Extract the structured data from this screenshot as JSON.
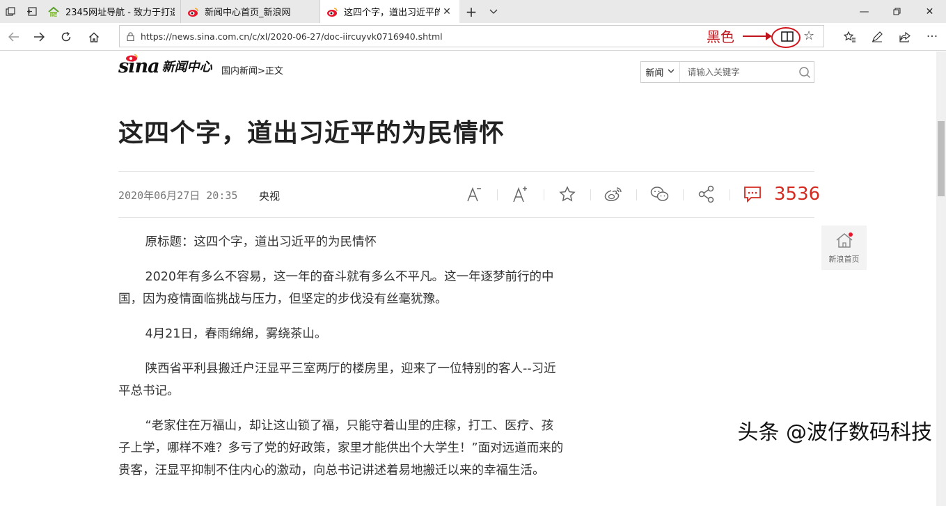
{
  "tabs": [
    {
      "title": "2345网址导航 - 致力于打造",
      "favicon": "house-favicon"
    },
    {
      "title": "新闻中心首页_新浪网",
      "favicon": "sina-eye-favicon"
    },
    {
      "title": "这四个字，道出习近平的",
      "favicon": "sina-eye-favicon",
      "active": true
    }
  ],
  "address": {
    "url": "https://news.sina.com.cn/c/xl/2020-06-27/doc-iircuyvk0716940.shtml"
  },
  "annotation": {
    "label": "黑色",
    "color": "#c0141c"
  },
  "site": {
    "logo_text": "sina",
    "section_name": "新闻中心",
    "breadcrumb": "国内新闻>正文"
  },
  "search": {
    "category": "新闻",
    "placeholder": "请输入关键字"
  },
  "article": {
    "title": "这四个字，道出习近平的为民情怀",
    "date": "2020年06月27日 20:35",
    "source": "央视",
    "comment_count": "3536",
    "paragraphs": [
      "原标题：这四个字，道出习近平的为民情怀",
      "2020年有多么不容易，这一年的奋斗就有多么不平凡。这一年逐梦前行的中国，因为疫情面临挑战与压力，但坚定的步伐没有丝毫犹豫。",
      "4月21日，春雨绵绵，雾绕茶山。",
      "陕西省平利县搬迁户汪显平三室两厅的楼房里，迎来了一位特别的客人--习近平总书记。",
      "“老家住在万福山，却让这山锁了福，只能守着山里的庄稼，打工、医疗、孩子上学，哪样不难？多亏了党的好政策，家里才能供出个大学生！”面对远道而来的贵客，汪显平抑制不住内心的激动，向总书记讲述着易地搬迁以来的幸福生活。"
    ]
  },
  "home_float": {
    "label": "新浪首页"
  },
  "watermark": "头条 @波仔数码科技",
  "colors": {
    "accent_red": "#d3291f",
    "tabbar_bg": "#e9e9e9"
  }
}
